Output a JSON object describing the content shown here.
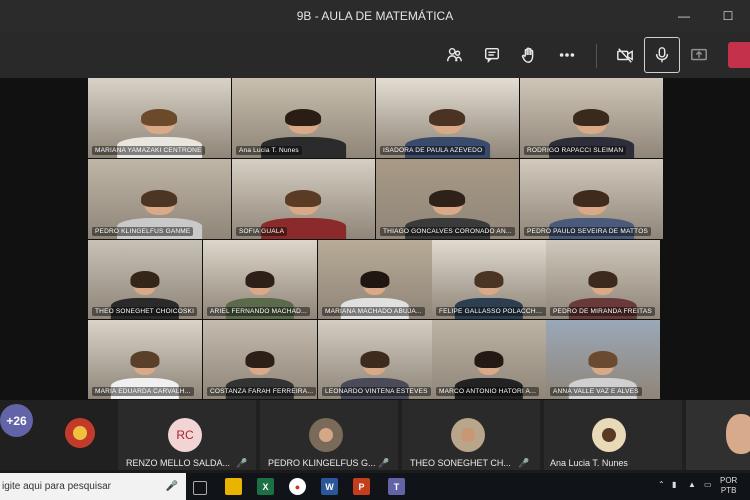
{
  "window": {
    "title": "9B - AULA DE MATEMÁTICA"
  },
  "toolbar": {
    "buttons": [
      "participants-icon",
      "chat-icon",
      "raise-hand-icon",
      "more-icon",
      "camera-off-icon",
      "microphone-icon",
      "share-icon",
      "leave-icon"
    ]
  },
  "participants": [
    "MARIANA YAMAZAKI CENTRONE",
    "Ana Lucia T. Nunes",
    "ISADORA DE PAULA AZEVEDO",
    "RODRIGO RAPACCI SLEIMAN",
    "PEDRO KLINGELFUS GANME",
    "SOFIA GUALA",
    "THIAGO GONCALVES CORONADO AN...",
    "PEDRO PAULO SEVEIRA DE MATTOS",
    "THEO SONEGHET CHOICOSKI",
    "ARIEL FERNANDO MACHAD...",
    "MARIANA MACHADO ABUJA...",
    "FELIPE GALLASSO POLACCHINI",
    "PEDRO DE MIRANDA FREITAS",
    "MARIA EDUARDA CARVALH...",
    "COSTANZA FARAH FERREIRA...",
    "LEONARDO VINTENA ESTEVES",
    "MARCO ANTONIO HATORI A...",
    "ANNA VALLE VAZ E ALVES"
  ],
  "tray": {
    "overflow_count": "+26",
    "items": [
      {
        "initials": "RC",
        "name": "RENZO MELLO SALDA..."
      },
      {
        "initials": "",
        "name": "PEDRO KLINGELFUS G..."
      },
      {
        "initials": "",
        "name": "THEO SONEGHET CH..."
      },
      {
        "initials": "",
        "name": "Ana Lucia T. Nunes"
      }
    ]
  },
  "taskbar": {
    "search_placeholder": "igite aqui para pesquisar",
    "lang_top": "POR",
    "lang_bottom": "PTB"
  },
  "colors": {
    "accent": "#6264a7",
    "leave": "#c4314b"
  }
}
